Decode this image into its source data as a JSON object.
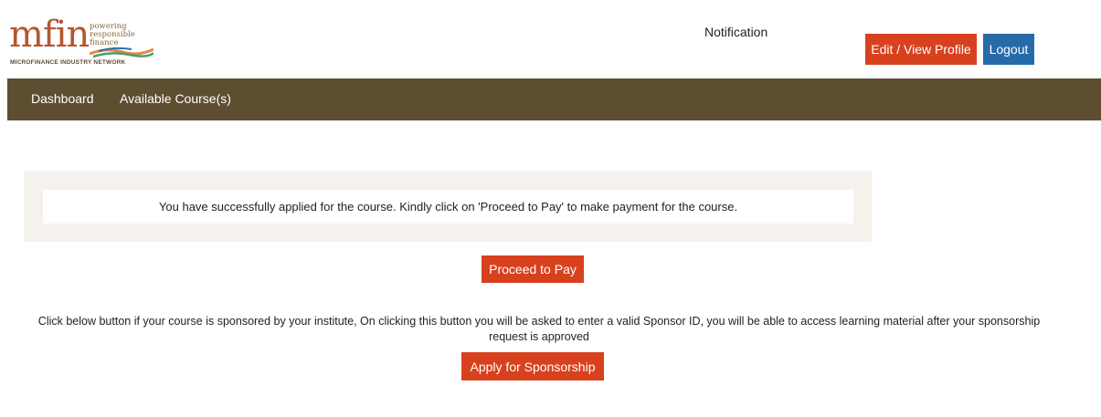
{
  "header": {
    "logo": {
      "mark": "mfin",
      "tagline": [
        "powering",
        "responsible",
        "finance"
      ],
      "subtitle": "MICROFINANCE INDUSTRY NETWORK"
    },
    "notification_label": "Notification",
    "edit_profile_label": "Edit / View Profile",
    "logout_label": "Logout"
  },
  "nav": {
    "items": [
      {
        "label": "Dashboard"
      },
      {
        "label": "Available Course(s)"
      }
    ]
  },
  "main": {
    "success_message": "You have successfully applied for the course. Kindly click on 'Proceed to Pay' to make payment for the course.",
    "proceed_label": "Proceed to Pay",
    "sponsor_info": "Click below button if your course is sponsored by your institute, On clicking this button you will be asked to enter a valid Sponsor ID, you will be able to access learning material after your sponsorship request is approved",
    "sponsor_label": "Apply for Sponsorship"
  },
  "colors": {
    "brand_brown": "#5e4e31",
    "action_red": "#d8411e",
    "logout_blue": "#276aa8",
    "notice_bg": "#f5f1ec"
  },
  "icons": {
    "logo": "mfin-logo"
  }
}
